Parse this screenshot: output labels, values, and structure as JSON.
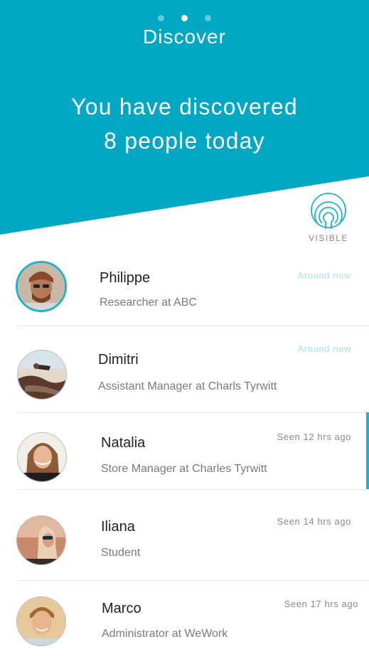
{
  "header": {
    "title": "Discover",
    "headline_line1": "You have discovered",
    "headline_line2": "8 people today",
    "pager": {
      "count": 3,
      "active_index": 1
    }
  },
  "visibility": {
    "label": "VISIBLE"
  },
  "people": [
    {
      "name": "Philippe",
      "role": "Researcher at ABC",
      "status": "Around now"
    },
    {
      "name": "Dimitri",
      "role": "Assistant Manager at Charls Tyrwitt",
      "status": "Around now"
    },
    {
      "name": "Natalia",
      "role": "Store Manager at Charles Tyrwitt",
      "status": "Seen 12 hrs ago"
    },
    {
      "name": "Iliana",
      "role": "Student",
      "status": "Seen 14 hrs ago"
    },
    {
      "name": "Marco",
      "role": "Administrator at WeWork",
      "status": "Seen 17 hrs ago"
    }
  ],
  "colors": {
    "accent": "#00a8c3",
    "ring": "#1fb2c8",
    "around_now": "#a8e4ec"
  }
}
